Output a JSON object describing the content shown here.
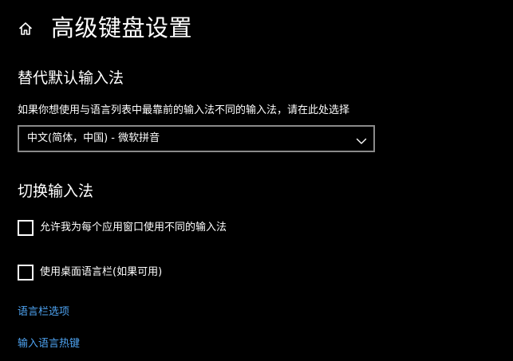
{
  "page": {
    "title": "高级键盘设置"
  },
  "icons": {
    "home": "home-icon",
    "chevron": "chevron-down-icon"
  },
  "colors": {
    "background": "#000000",
    "text": "#ffffff",
    "link": "#4ea3f1",
    "select_border": "#8a8a8a"
  },
  "override_input": {
    "heading": "替代默认输入法",
    "description": "如果你想使用与语言列表中最靠前的输入法不同的输入法，请在此处选择",
    "selected_value": "中文(简体，中国) - 微软拼音"
  },
  "switch_input": {
    "heading": "切换输入法",
    "options": [
      {
        "label": "允许我为每个应用窗口使用不同的输入法",
        "checked": false
      },
      {
        "label": "使用桌面语言栏(如果可用)",
        "checked": false
      }
    ]
  },
  "links": {
    "language_bar_options": "语言栏选项",
    "input_language_hotkeys": "输入语言热键"
  }
}
